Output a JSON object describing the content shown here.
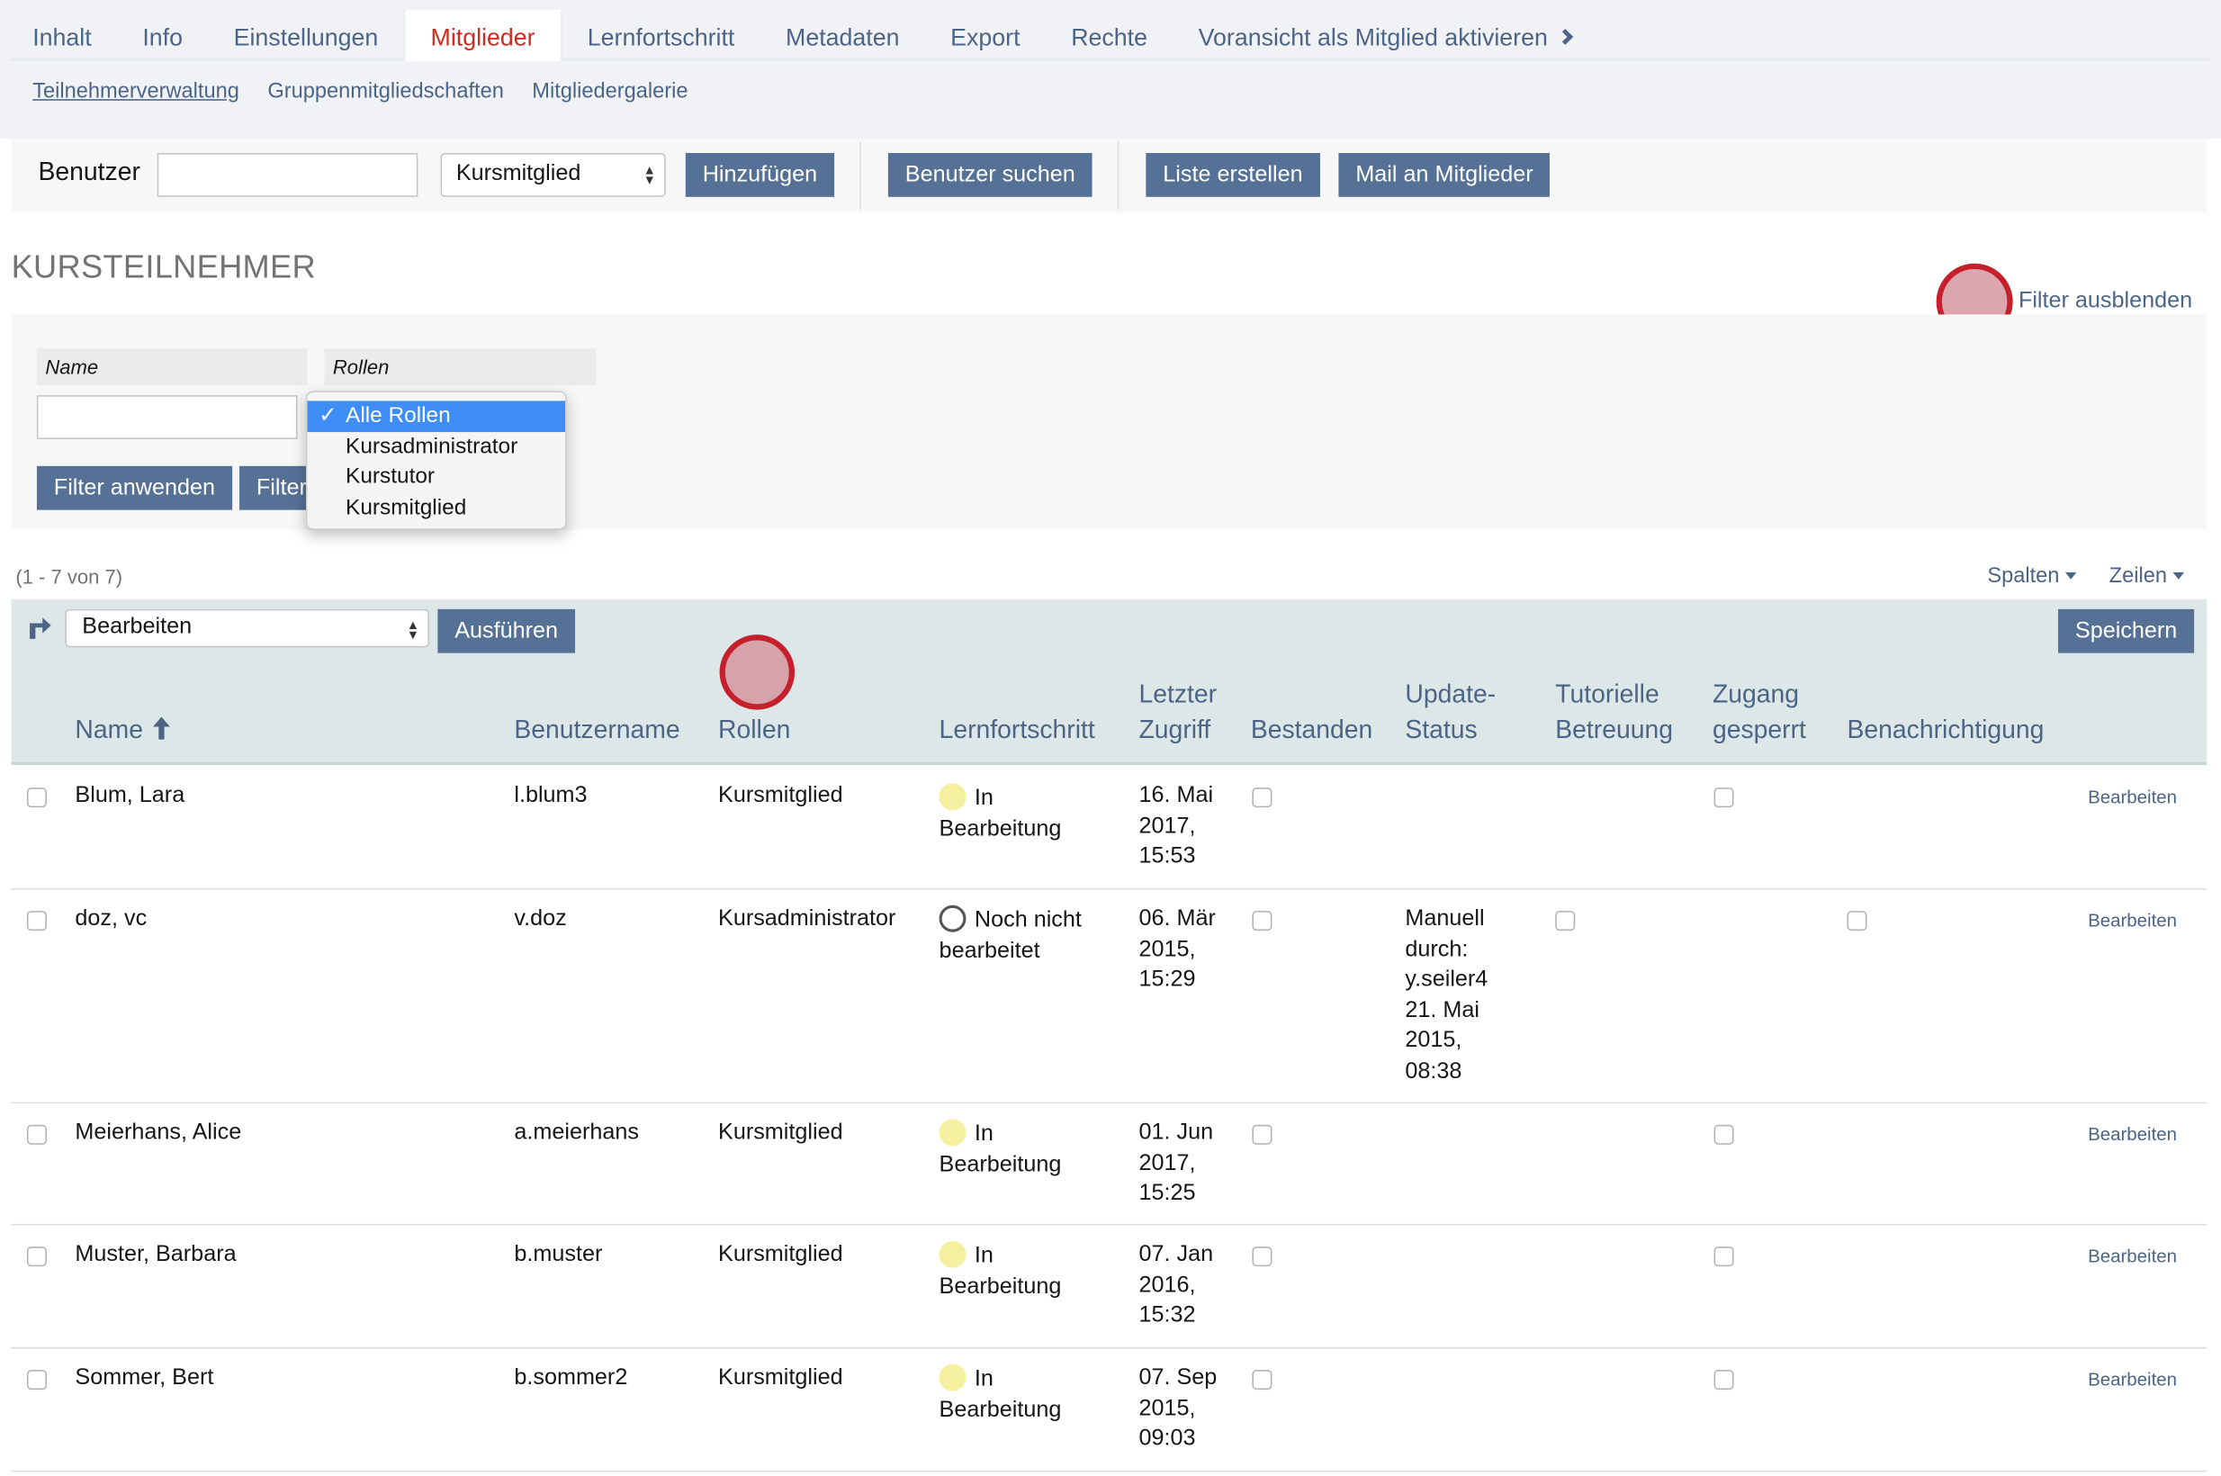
{
  "tabs": [
    {
      "label": "Inhalt"
    },
    {
      "label": "Info"
    },
    {
      "label": "Einstellungen"
    },
    {
      "label": "Mitglieder"
    },
    {
      "label": "Lernfortschritt"
    },
    {
      "label": "Metadaten"
    },
    {
      "label": "Export"
    },
    {
      "label": "Rechte"
    },
    {
      "label": "Voransicht als Mitglied aktivieren"
    }
  ],
  "active_tab": "Mitglieder",
  "subtabs": [
    {
      "label": "Teilnehmerverwaltung"
    },
    {
      "label": "Gruppenmitgliedschaften"
    },
    {
      "label": "Mitgliedergalerie"
    }
  ],
  "toolbar": {
    "user_label": "Benutzer",
    "user_input_value": "",
    "role_select_value": "Kursmitglied",
    "add_button": "Hinzufügen",
    "search_users_button": "Benutzer suchen",
    "create_list_button": "Liste erstellen",
    "mail_button": "Mail an Mitglieder"
  },
  "section_title": "KURSTEILNEHMER",
  "filter_toggle": "Filter ausblenden",
  "filter": {
    "name_label": "Name",
    "roles_label": "Rollen",
    "name_value": "",
    "apply_button": "Filter anwenden",
    "reset_button_partial": "Filter",
    "role_options": [
      "Alle Rollen",
      "Kursadministrator",
      "Kurstutor",
      "Kursmitglied"
    ],
    "selected_role": "Alle Rollen",
    "check_mark": "✓"
  },
  "table_meta": {
    "count": "(1 - 7 von 7)",
    "columns_link": "Spalten",
    "rows_link": "Zeilen"
  },
  "table_actions": {
    "action_select_value": "Bearbeiten",
    "execute_button": "Ausführen",
    "save_button": "Speichern"
  },
  "columns": {
    "name": "Name",
    "username": "Benutzername",
    "roles": "Rollen",
    "progress": "Lernfortschritt",
    "last_access_1": "Letzter",
    "last_access_2": "Zugriff",
    "passed": "Bestanden",
    "update_1": "Update-",
    "update_2": "Status",
    "tutorial_1": "Tutorielle",
    "tutorial_2": "Betreuung",
    "locked_1": "Zugang",
    "locked_2": "gesperrt",
    "notification": "Benachrichtigung"
  },
  "rows": [
    {
      "name": "Blum, Lara",
      "username": "l.blum3",
      "role": "Kursmitglied",
      "progress_1": "In",
      "progress_2": "Bearbeitung",
      "progress_status": "in-progress",
      "access": [
        "16. Mai",
        "2017,",
        "15:53"
      ],
      "update": [],
      "edit": "Bearbeiten"
    },
    {
      "name": "doz, vc",
      "username": "v.doz",
      "role": "Kursadministrator",
      "progress_1": "Noch nicht",
      "progress_2": "bearbeitet",
      "progress_status": "not-attempted",
      "access": [
        "06. Mär",
        "2015,",
        "15:29"
      ],
      "update": [
        "Manuell",
        "durch:",
        "y.seiler4",
        "21. Mai",
        "2015,",
        "08:38"
      ],
      "edit": "Bearbeiten"
    },
    {
      "name": "Meierhans, Alice",
      "username": "a.meierhans",
      "role": "Kursmitglied",
      "progress_1": "In",
      "progress_2": "Bearbeitung",
      "progress_status": "in-progress",
      "access": [
        "01. Jun",
        "2017,",
        "15:25"
      ],
      "update": [],
      "edit": "Bearbeiten"
    },
    {
      "name": "Muster, Barbara",
      "username": "b.muster",
      "role": "Kursmitglied",
      "progress_1": "In",
      "progress_2": "Bearbeitung",
      "progress_status": "in-progress",
      "access": [
        "07. Jan",
        "2016,",
        "15:32"
      ],
      "update": [],
      "edit": "Bearbeiten"
    },
    {
      "name": "Sommer, Bert",
      "username": "b.sommer2",
      "role": "Kursmitglied",
      "progress_1": "In",
      "progress_2": "Bearbeitung",
      "progress_status": "in-progress",
      "access": [
        "07. Sep",
        "2015,",
        "09:03"
      ],
      "update": [],
      "edit": "Bearbeiten"
    }
  ],
  "colors": {
    "link": "#4c6586",
    "active_tab": "#d02b20",
    "button": "#557196",
    "header_bg": "#dde7e8",
    "marker": "#c5202c",
    "in_progress_dot": "#f5f0a0"
  }
}
